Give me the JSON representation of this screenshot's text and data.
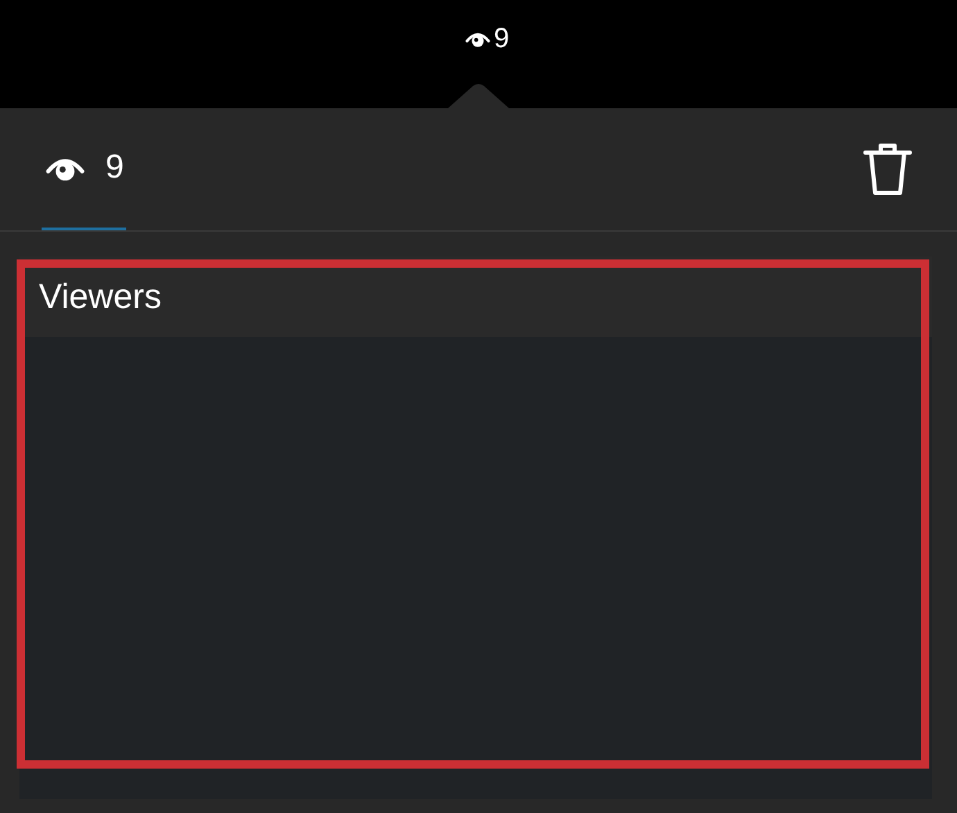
{
  "top_bar": {
    "viewer_count": "9"
  },
  "tabs": [
    {
      "label": "9",
      "selected": true
    }
  ],
  "list": {
    "title": "Viewers",
    "highlighted": true
  }
}
